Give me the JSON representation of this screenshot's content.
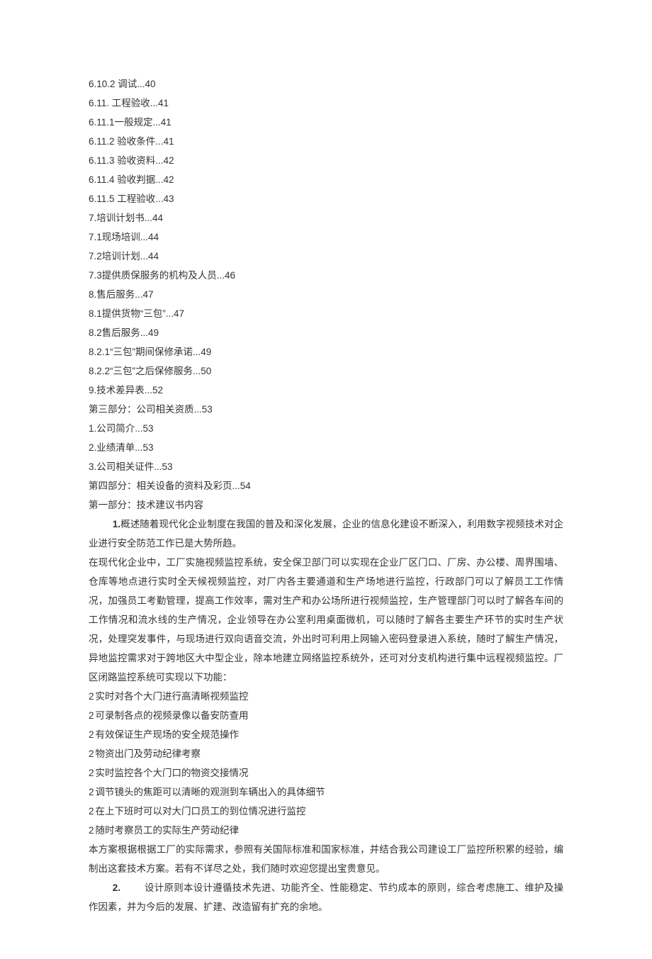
{
  "toc": [
    "6.10.2   调试...40",
    "6.11.   工程验收...41",
    "6.11.1一般规定...41",
    "6.11.2   验收条件...41",
    "6.11.3   验收资料...42",
    "6.11.4   验收判据...42",
    "6.11.5   工程验收...43",
    "7.培训计划书...44",
    "7.1现场培训...44",
    "7.2培训计划...44",
    "7.3提供质保服务的机构及人员...46",
    "8.售后服务...47",
    "8.1提供货物“三包”...47",
    "8.2售后服务...49",
    "8.2.1“三包”期间保修承诺...49",
    "8.2.2“三包”之后保修服务...50",
    "9.技术差异表...52",
    "第三部分：公司相关资质...53",
    "1.公司简介...53",
    "2.业绩清单...53",
    "3.公司相关证件...53",
    "第四部分：相关设备的资料及彩页...54",
    "第一部分：技术建议书内容"
  ],
  "para1_lead_num": "1.",
  "para1_text": "概述随着现代化企业制度在我国的普及和深化发展，企业的信息化建设不断深入，利用数字视频技术对企业进行安全防范工作已是大势所趋。",
  "para2_text": "在现代化企业中，工厂实施视频监控系统，安全保卫部门可以实现在企业厂区门口、厂房、办公楼、周界围墙、仓库等地点进行实时全天候视频监控，对厂内各主要通道和生产场地进行监控，行政部门可以了解员工工作情况，加强员工考勤管理，提高工作效率，需对生产和办公场所进行视频监控，生产管理部门可以时了解各车间的工作情况和流水线的生产情况，企业领导在办公室利用桌面微机，可以随时了解各主要生产环节的实时生产状况，处理突发事件，与现场进行双向语音交流，外出时可利用上网输入密码登录进入系统，随时了解生产情况，异地监控需求对于跨地区大中型企业，除本地建立网络监控系统外，还可对分支机构进行集中远程视频监控。厂区闭路监控系统可实现以下功能：",
  "bullets": [
    "实时对各个大门进行高清晰视频监控",
    "可录制各点的视频录像以备安防查用",
    "有效保证生产现场的安全规范操作",
    "物资出门及劳动纪律考察",
    "实时监控各个大门口的物资交接情况",
    "调节镜头的焦距可以清晰的观测到车辆出入的具体细节",
    "在上下班时可以对大门口员工的到位情况进行监控",
    "随时考察员工的实际生产劳动纪律"
  ],
  "para3_text": "本方案根据根据工厂的实际需求，参照有关国际标准和国家标准，并结合我公司建设工厂监控所积累的经验，编制出这套技术方案。若有不详尽之处，我们随时欢迎您提出宝贵意见。",
  "para4_lead_num": "2.",
  "para4_text": "设计原则本设计遵循技术先进、功能齐全、性能稳定、节约成本的原则，综合考虑施工、维护及操作因素，并为今后的发展、扩建、改造留有扩充的余地。"
}
